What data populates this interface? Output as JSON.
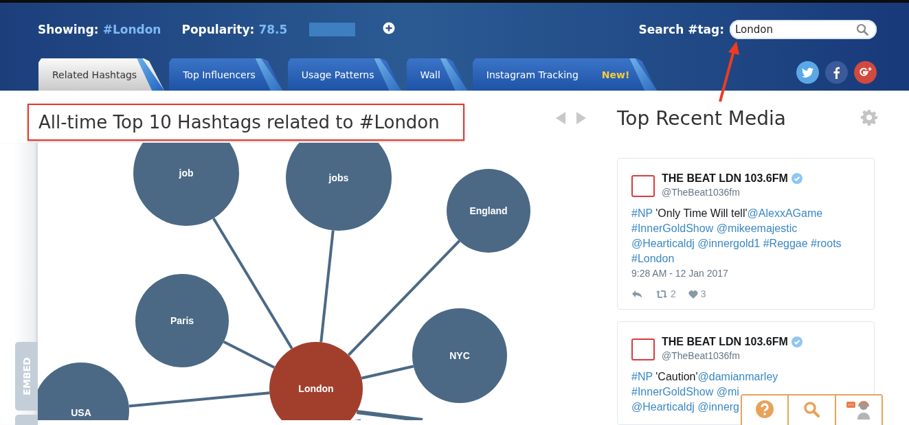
{
  "header": {
    "showing_label": "Showing:",
    "showing_value": "#London",
    "popularity_label": "Popularity:",
    "popularity_value": "78.5",
    "search_label": "Search #tag:",
    "search_value": "London"
  },
  "tabs": [
    {
      "label": "Related Hashtags",
      "selected": true
    },
    {
      "label": "Top Influencers",
      "selected": false
    },
    {
      "label": "Usage Patterns",
      "selected": false
    },
    {
      "label": "Wall",
      "selected": false
    },
    {
      "label": "Instagram Tracking",
      "selected": false,
      "badge": "New!"
    }
  ],
  "main": {
    "title": "All-time Top 10 Hashtags related to #London",
    "embed_tab": "EMBED"
  },
  "graph": {
    "nodes": [
      {
        "label": "job",
        "kind": "related"
      },
      {
        "label": "jobs",
        "kind": "related"
      },
      {
        "label": "England",
        "kind": "related"
      },
      {
        "label": "Paris",
        "kind": "related"
      },
      {
        "label": "NYC",
        "kind": "related"
      },
      {
        "label": "London",
        "kind": "center"
      },
      {
        "label": "USA",
        "kind": "related"
      }
    ]
  },
  "media": {
    "title": "Top Recent Media",
    "tweets": [
      {
        "name": "THE BEAT LDN 103.6FM",
        "verified": true,
        "handle": "@TheBeat1036fm",
        "lines": [
          [
            {
              "text": "#NP",
              "kind": "link"
            },
            {
              "text": " 'Only Time Will tell'",
              "kind": "plain"
            },
            {
              "text": "@AlexxAGame",
              "kind": "link"
            }
          ],
          [
            {
              "text": "#InnerGoldShow",
              "kind": "link"
            },
            {
              "text": "@mikeemajestic",
              "kind": "link"
            }
          ],
          [
            {
              "text": "@Hearticaldj",
              "kind": "link"
            },
            {
              "text": "@innergold1",
              "kind": "link"
            },
            {
              "text": "#Reggae",
              "kind": "link"
            },
            {
              "text": "#roots",
              "kind": "link"
            }
          ],
          [
            {
              "text": "#London",
              "kind": "link"
            }
          ]
        ],
        "time": "9:28 AM - 12 Jan 2017",
        "retweets": "2",
        "likes": "3"
      },
      {
        "name": "THE BEAT LDN 103.6FM",
        "verified": true,
        "handle": "@TheBeat1036fm",
        "lines": [
          [
            {
              "text": "#NP",
              "kind": "link"
            },
            {
              "text": " 'Caution'",
              "kind": "plain"
            },
            {
              "text": "@damianmarley",
              "kind": "link"
            }
          ],
          [
            {
              "text": "#InnerGoldShow",
              "kind": "link"
            },
            {
              "text": "@mi",
              "kind": "link"
            }
          ],
          [
            {
              "text": "@Hearticaldj",
              "kind": "link"
            },
            {
              "text": "@innerg",
              "kind": "link"
            }
          ]
        ]
      }
    ]
  }
}
